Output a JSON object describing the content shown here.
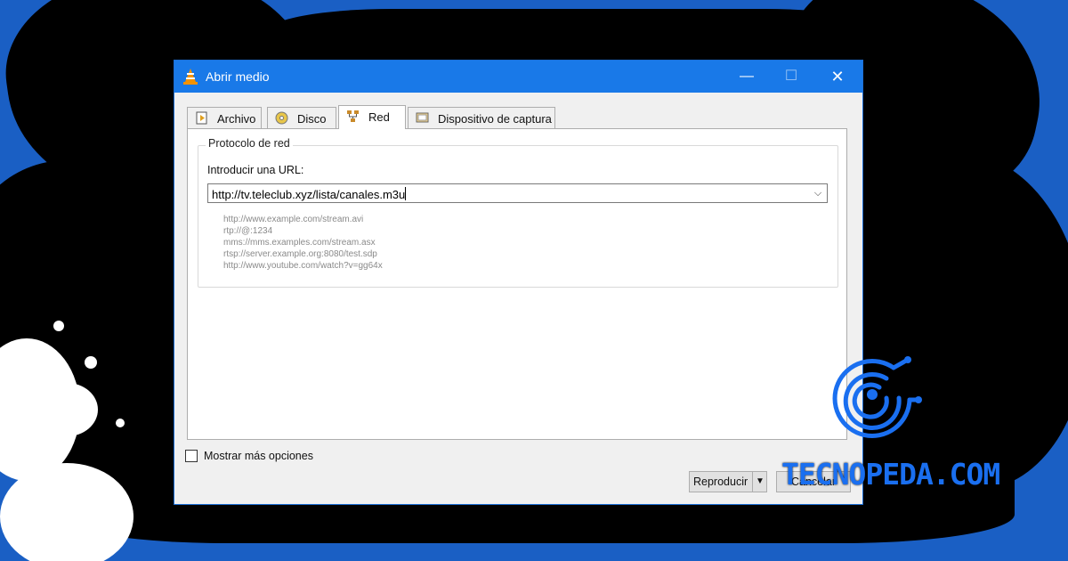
{
  "window": {
    "title": "Abrir medio",
    "icon": "vlc-cone-icon",
    "controls": {
      "minimize": "—",
      "maximize": "☐",
      "close": "✕"
    }
  },
  "tabs": [
    {
      "label": "Archivo",
      "icon": "file-play-icon",
      "active": false
    },
    {
      "label": "Disco",
      "icon": "disc-icon",
      "active": false
    },
    {
      "label": "Red",
      "icon": "network-icon",
      "active": true
    },
    {
      "label": "Dispositivo de captura",
      "icon": "capture-device-icon",
      "active": false
    }
  ],
  "network": {
    "group_title": "Protocolo de red",
    "url_label": "Introducir una URL:",
    "url_value": "http://tv.teleclub.xyz/lista/canales.m3u",
    "examples": [
      "http://www.example.com/stream.avi",
      "rtp://@:1234",
      "mms://mms.examples.com/stream.asx",
      "rtsp://server.example.org:8080/test.sdp",
      "http://www.youtube.com/watch?v=gg64x"
    ]
  },
  "options": {
    "show_more_label": "Mostrar más opciones",
    "show_more_checked": false
  },
  "buttons": {
    "play_label": "Reproducir",
    "play_dropdown": "▼",
    "cancel_label": "Cancelar"
  },
  "brand": {
    "text": "TECNOPEDA.COM",
    "color": "#1a6ff0"
  },
  "colors": {
    "titlebar": "#1979e8",
    "background": "#1a5fc4"
  }
}
